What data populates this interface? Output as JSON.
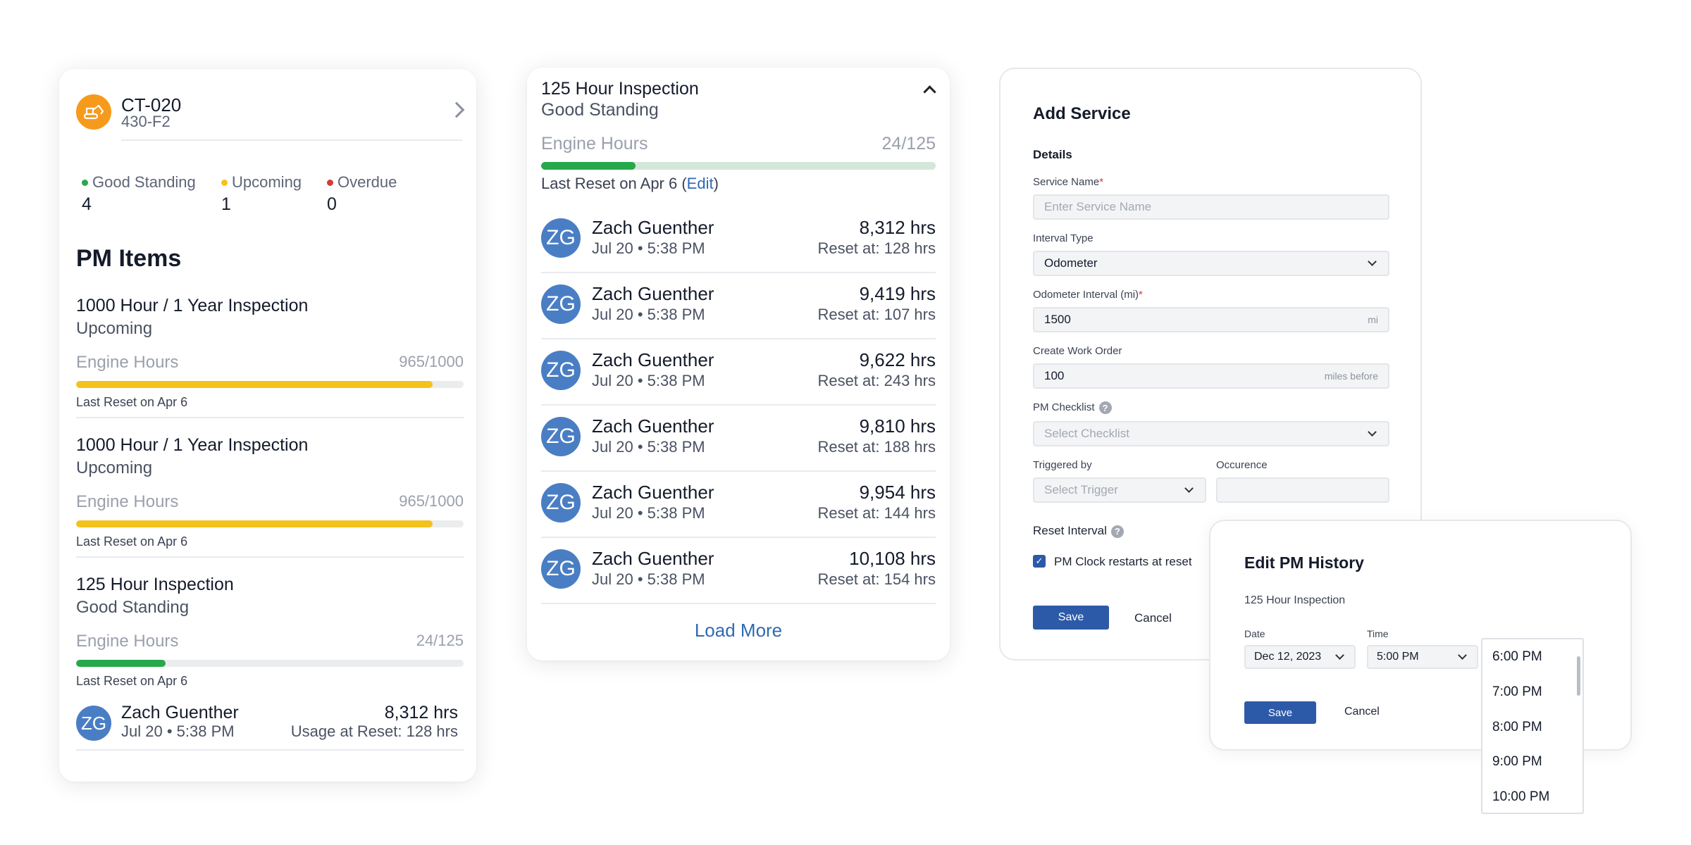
{
  "asset_card": {
    "asset_id": "CT-020",
    "asset_model": "430-F2",
    "icon": "excavator-icon",
    "stats": [
      {
        "label": "Good Standing",
        "value": "4",
        "color": "#27a84a"
      },
      {
        "label": "Upcoming",
        "value": "1",
        "color": "#f4c21b"
      },
      {
        "label": "Overdue",
        "value": "0",
        "color": "#d43b3b"
      }
    ],
    "section_title": "PM Items",
    "pm_items": [
      {
        "name": "1000 Hour / 1 Year Inspection",
        "status": "Upcoming",
        "metric": "Engine Hours",
        "value": "965/1000",
        "progress": 0.92,
        "color": "#f4c21b",
        "reset": "Last Reset on Apr 6"
      },
      {
        "name": "1000 Hour / 1 Year Inspection",
        "status": "Upcoming",
        "metric": "Engine Hours",
        "value": "965/1000",
        "progress": 0.92,
        "color": "#f4c21b",
        "reset": "Last Reset on Apr 6"
      },
      {
        "name": "125 Hour Inspection",
        "status": "Good Standing",
        "metric": "Engine Hours",
        "value": "24/125",
        "progress": 0.23,
        "color": "#27a84a",
        "reset": "Last Reset on Apr 6"
      }
    ],
    "history_entry": {
      "initials": "ZG",
      "name": "Zach Guenther",
      "date": "Jul 20",
      "time": "5:38 PM",
      "hours": "8,312 hrs",
      "reset": "Usage at Reset: 128 hrs"
    }
  },
  "inspection_card": {
    "title": "125 Hour Inspection",
    "status": "Good Standing",
    "metric": "Engine Hours",
    "value": "24/125",
    "progress": 0.24,
    "reset_prefix": "Last Reset on Apr 6 (",
    "edit_label": "Edit",
    "reset_suffix": ")",
    "history": [
      {
        "initials": "ZG",
        "name": "Zach Guenther",
        "date": "Jul 20",
        "time": "5:38 PM",
        "hours": "8,312 hrs",
        "reset": "Reset at: 128 hrs"
      },
      {
        "initials": "ZG",
        "name": "Zach Guenther",
        "date": "Jul 20",
        "time": "5:38 PM",
        "hours": "9,419 hrs",
        "reset": "Reset at: 107 hrs"
      },
      {
        "initials": "ZG",
        "name": "Zach Guenther",
        "date": "Jul 20",
        "time": "5:38 PM",
        "hours": "9,622 hrs",
        "reset": "Reset at: 243 hrs"
      },
      {
        "initials": "ZG",
        "name": "Zach Guenther",
        "date": "Jul 20",
        "time": "5:38 PM",
        "hours": "9,810 hrs",
        "reset": "Reset at: 188 hrs"
      },
      {
        "initials": "ZG",
        "name": "Zach Guenther",
        "date": "Jul 20",
        "time": "5:38 PM",
        "hours": "9,954 hrs",
        "reset": "Reset at: 144 hrs"
      },
      {
        "initials": "ZG",
        "name": "Zach Guenther",
        "date": "Jul 20",
        "time": "5:38 PM",
        "hours": "10,108 hrs",
        "reset": "Reset at: 154 hrs"
      }
    ],
    "load_more": "Load More"
  },
  "add_service": {
    "title": "Add Service",
    "section": "Details",
    "service_name_label": "Service Name",
    "service_name_placeholder": "Enter Service Name",
    "interval_type_label": "Interval Type",
    "interval_type_value": "Odometer",
    "odometer_label": "Odometer Interval (mi)",
    "odometer_value": "1500",
    "odometer_unit": "mi",
    "work_order_label": "Create Work Order",
    "work_order_value": "100",
    "work_order_unit": "miles before",
    "checklist_label": "PM Checklist",
    "checklist_placeholder": "Select Checklist",
    "triggered_label": "Triggered by",
    "triggered_placeholder": "Select Trigger",
    "occurence_label": "Occurence",
    "reset_label": "Reset Interval",
    "reset_checkbox_label": "PM Clock restarts at reset",
    "save": "Save",
    "cancel": "Cancel",
    "required_mark": "*",
    "help_glyph": "?",
    "accent": "#2d5aa8"
  },
  "edit_history": {
    "title": "Edit PM History",
    "subtitle": "125 Hour Inspection",
    "date_label": "Date",
    "date_value": "Dec 12, 2023",
    "time_label": "Time",
    "time_value": "5:00 PM",
    "save": "Save",
    "cancel": "Cancel",
    "time_options": [
      "6:00 PM",
      "7:00 PM",
      "8:00 PM",
      "9:00 PM",
      "10:00 PM"
    ]
  }
}
